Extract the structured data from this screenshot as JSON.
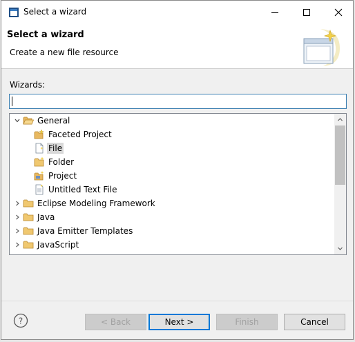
{
  "window": {
    "title": "Select a wizard"
  },
  "banner": {
    "title": "Select a wizard",
    "description": "Create a new file resource"
  },
  "filter": {
    "label": "Wizards:",
    "value": ""
  },
  "tree": {
    "items": [
      {
        "label": "General",
        "expanded": true,
        "icon": "folder-open-icon"
      },
      {
        "label": "Faceted Project",
        "icon": "faceted-project-icon"
      },
      {
        "label": "File",
        "icon": "file-icon",
        "selected": true
      },
      {
        "label": "Folder",
        "icon": "folder-icon"
      },
      {
        "label": "Project",
        "icon": "project-icon"
      },
      {
        "label": "Untitled Text File",
        "icon": "text-file-icon"
      },
      {
        "label": "Eclipse Modeling Framework",
        "expanded": false,
        "icon": "folder-icon"
      },
      {
        "label": "Java",
        "expanded": false,
        "icon": "folder-icon"
      },
      {
        "label": "Java Emitter Templates",
        "expanded": false,
        "icon": "folder-icon"
      },
      {
        "label": "JavaScript",
        "expanded": false,
        "icon": "folder-icon"
      }
    ]
  },
  "buttons": {
    "help": "?",
    "back": "< Back",
    "next": "Next >",
    "finish": "Finish",
    "cancel": "Cancel"
  },
  "colors": {
    "accent": "#0078d7",
    "folder": "#e8c070",
    "selection": "#d9d9d9"
  }
}
